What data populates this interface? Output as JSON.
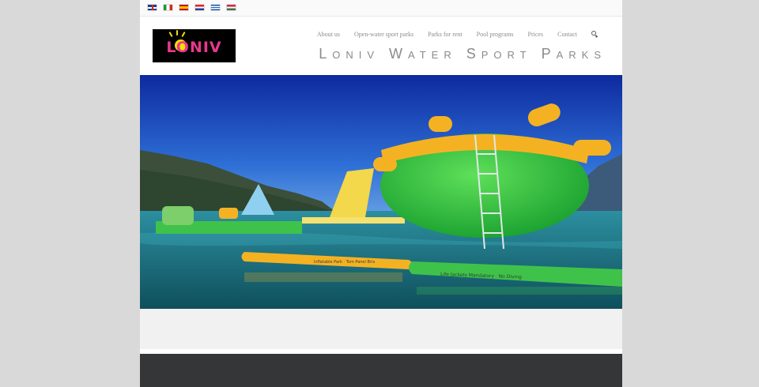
{
  "languages": [
    "en",
    "it",
    "es",
    "hr",
    "gr",
    "hu"
  ],
  "logo": {
    "text": "LONIV"
  },
  "nav": {
    "items": [
      {
        "label": "About us"
      },
      {
        "label": "Open-water sport parks"
      },
      {
        "label": "Parks for rent"
      },
      {
        "label": "Pool programs"
      },
      {
        "label": "Prices"
      },
      {
        "label": "Contact"
      }
    ],
    "search_icon": "search-icon"
  },
  "site_title": "Loniv Water Sport Parks",
  "hero": {
    "description_icon": "inflatable-water-park-photo",
    "boom_text_1": "Inflatable Park · Tom Panel Brix",
    "boom_text_2": "Life Jackets Mandatory · No Diving"
  },
  "colors": {
    "background": "#d9d9d9",
    "footer": "#353638",
    "inflatable_green": "#3fc24a",
    "inflatable_yellow": "#f4b223",
    "logo_pink": "#e8388d"
  }
}
